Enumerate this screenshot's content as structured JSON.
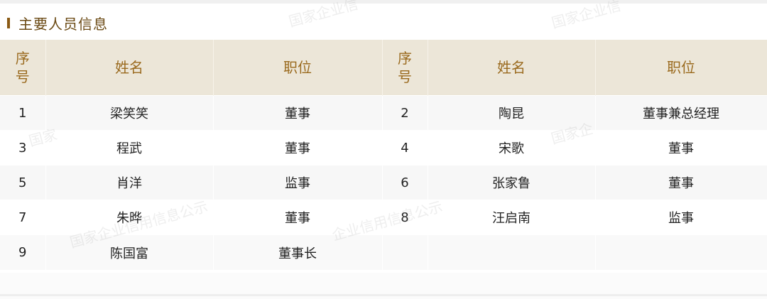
{
  "section": {
    "title": "主要人员信息"
  },
  "table": {
    "headers": [
      "序号",
      "姓名",
      "职位",
      "序号",
      "姓名",
      "职位"
    ],
    "rows": [
      [
        "1",
        "梁笑笑",
        "董事",
        "2",
        "陶昆",
        "董事兼总经理"
      ],
      [
        "3",
        "程武",
        "董事",
        "4",
        "宋歌",
        "董事"
      ],
      [
        "5",
        "肖洋",
        "监事",
        "6",
        "张家鲁",
        "董事"
      ],
      [
        "7",
        "朱晔",
        "董事",
        "8",
        "汪启南",
        "监事"
      ],
      [
        "9",
        "陈国富",
        "董事长",
        "",
        "",
        ""
      ]
    ]
  },
  "watermark": {
    "text_1": "国家企业信",
    "text_2": "国家企业信",
    "text_3": "国家",
    "text_4": "国家企",
    "text_5": "国家企业信用信息公示",
    "text_6": "企业信用信息公示"
  },
  "colors": {
    "header_bg": "#ece6d8",
    "header_text": "#9a6a1e",
    "title_text": "#6b4a14",
    "accent_bar": "#8a5a14"
  }
}
